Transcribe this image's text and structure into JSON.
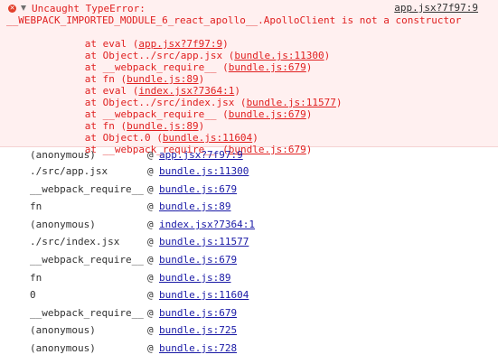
{
  "error": {
    "header": "Uncaught TypeError:",
    "message": "__WEBPACK_IMPORTED_MODULE_6_react_apollo__.ApolloClient is not a constructor",
    "source_link": "app.jsx?7f97:9",
    "frames": [
      {
        "prefix": "at eval (",
        "loc": "app.jsx?7f97:9",
        "suffix": ")"
      },
      {
        "prefix": "at Object../src/app.jsx (",
        "loc": "bundle.js:11300",
        "suffix": ")"
      },
      {
        "prefix": "at __webpack_require__ (",
        "loc": "bundle.js:679",
        "suffix": ")"
      },
      {
        "prefix": "at fn (",
        "loc": "bundle.js:89",
        "suffix": ")"
      },
      {
        "prefix": "at eval (",
        "loc": "index.jsx?7364:1",
        "suffix": ")"
      },
      {
        "prefix": "at Object../src/index.jsx (",
        "loc": "bundle.js:11577",
        "suffix": ")"
      },
      {
        "prefix": "at __webpack_require__ (",
        "loc": "bundle.js:679",
        "suffix": ")"
      },
      {
        "prefix": "at fn (",
        "loc": "bundle.js:89",
        "suffix": ")"
      },
      {
        "prefix": "at Object.0 (",
        "loc": "bundle.js:11604",
        "suffix": ")"
      },
      {
        "prefix": "at __webpack_require__ (",
        "loc": "bundle.js:679",
        "suffix": ")"
      }
    ]
  },
  "stack": {
    "rows": [
      {
        "fn": "(anonymous)",
        "at": "@",
        "link": "app.jsx?7f97:9"
      },
      {
        "fn": "./src/app.jsx",
        "at": "@",
        "link": "bundle.js:11300"
      },
      {
        "fn": "__webpack_require__",
        "at": "@",
        "link": "bundle.js:679"
      },
      {
        "fn": "fn",
        "at": "@",
        "link": "bundle.js:89"
      },
      {
        "fn": "(anonymous)",
        "at": "@",
        "link": "index.jsx?7364:1"
      },
      {
        "fn": "./src/index.jsx",
        "at": "@",
        "link": "bundle.js:11577"
      },
      {
        "fn": "__webpack_require__",
        "at": "@",
        "link": "bundle.js:679"
      },
      {
        "fn": "fn",
        "at": "@",
        "link": "bundle.js:89"
      },
      {
        "fn": "0",
        "at": "@",
        "link": "bundle.js:11604"
      },
      {
        "fn": "__webpack_require__",
        "at": "@",
        "link": "bundle.js:679"
      },
      {
        "fn": "(anonymous)",
        "at": "@",
        "link": "bundle.js:725"
      },
      {
        "fn": "(anonymous)",
        "at": "@",
        "link": "bundle.js:728"
      }
    ]
  },
  "colors": {
    "error_text": "#e02020",
    "error_background": "#fff0f0",
    "link": "#1a1aa6"
  },
  "icons": {
    "error": "error-circle-icon",
    "expand": "triangle-down-icon"
  }
}
